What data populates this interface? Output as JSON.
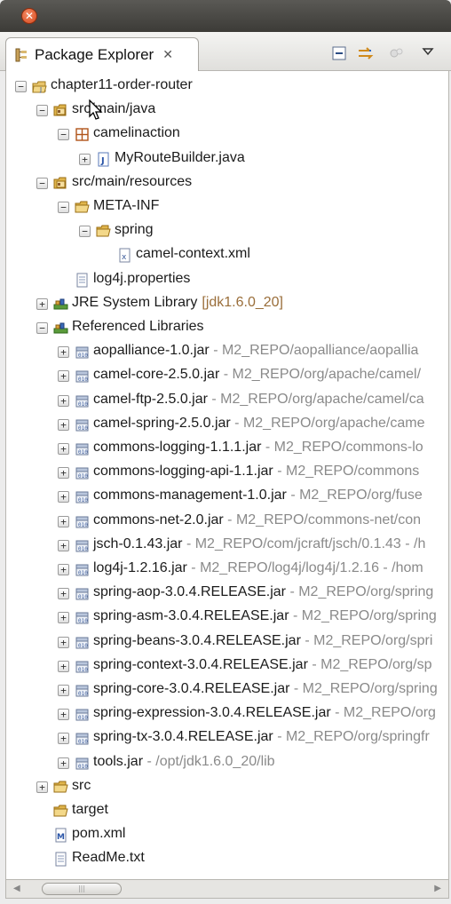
{
  "window": {
    "close_glyph": "✕"
  },
  "view": {
    "tab_title": "Package Explorer",
    "tab_close_glyph": "✕",
    "toolbar_icons": [
      "collapse-all-icon",
      "link-with-editor-icon",
      "focus-icon",
      "view-menu-icon"
    ]
  },
  "tree": [
    {
      "depth": 0,
      "toggle": "−",
      "icon": "project-icon",
      "label": "chapter11-order-router",
      "decoration": ""
    },
    {
      "depth": 1,
      "toggle": "−",
      "icon": "source-folder-icon",
      "label": "src/main/java",
      "decoration": ""
    },
    {
      "depth": 2,
      "toggle": "−",
      "icon": "package-icon",
      "label": "camelinaction",
      "decoration": ""
    },
    {
      "depth": 3,
      "toggle": "+",
      "icon": "java-file-icon",
      "label": "MyRouteBuilder.java",
      "decoration": ""
    },
    {
      "depth": 1,
      "toggle": "−",
      "icon": "source-folder-icon",
      "label": "src/main/resources",
      "decoration": ""
    },
    {
      "depth": 2,
      "toggle": "−",
      "icon": "folder-open-icon",
      "label": "META-INF",
      "decoration": ""
    },
    {
      "depth": 3,
      "toggle": "−",
      "icon": "folder-open-icon",
      "label": "spring",
      "decoration": ""
    },
    {
      "depth": 4,
      "toggle": "",
      "icon": "xml-file-icon",
      "label": "camel-context.xml",
      "decoration": ""
    },
    {
      "depth": 2,
      "toggle": "",
      "icon": "properties-file-icon",
      "label": "log4j.properties",
      "decoration": ""
    },
    {
      "depth": 1,
      "toggle": "+",
      "icon": "library-icon",
      "label": "JRE System Library",
      "decoration": "[jdk1.6.0_20]"
    },
    {
      "depth": 1,
      "toggle": "−",
      "icon": "library-icon",
      "label": "Referenced Libraries",
      "decoration": ""
    },
    {
      "depth": 2,
      "toggle": "+",
      "icon": "jar-icon",
      "label": "aopalliance-1.0.jar",
      "decoration": " - M2_REPO/aopalliance/aopallia"
    },
    {
      "depth": 2,
      "toggle": "+",
      "icon": "jar-icon",
      "label": "camel-core-2.5.0.jar",
      "decoration": " - M2_REPO/org/apache/camel/"
    },
    {
      "depth": 2,
      "toggle": "+",
      "icon": "jar-icon",
      "label": "camel-ftp-2.5.0.jar",
      "decoration": " - M2_REPO/org/apache/camel/ca"
    },
    {
      "depth": 2,
      "toggle": "+",
      "icon": "jar-icon",
      "label": "camel-spring-2.5.0.jar",
      "decoration": " - M2_REPO/org/apache/came"
    },
    {
      "depth": 2,
      "toggle": "+",
      "icon": "jar-icon",
      "label": "commons-logging-1.1.1.jar",
      "decoration": " - M2_REPO/commons-lo"
    },
    {
      "depth": 2,
      "toggle": "+",
      "icon": "jar-icon",
      "label": "commons-logging-api-1.1.jar",
      "decoration": " - M2_REPO/commons"
    },
    {
      "depth": 2,
      "toggle": "+",
      "icon": "jar-icon",
      "label": "commons-management-1.0.jar",
      "decoration": " - M2_REPO/org/fuse"
    },
    {
      "depth": 2,
      "toggle": "+",
      "icon": "jar-icon",
      "label": "commons-net-2.0.jar",
      "decoration": " - M2_REPO/commons-net/con"
    },
    {
      "depth": 2,
      "toggle": "+",
      "icon": "jar-icon",
      "label": "jsch-0.1.43.jar",
      "decoration": " - M2_REPO/com/jcraft/jsch/0.1.43 - /h"
    },
    {
      "depth": 2,
      "toggle": "+",
      "icon": "jar-icon",
      "label": "log4j-1.2.16.jar",
      "decoration": " - M2_REPO/log4j/log4j/1.2.16 - /hom"
    },
    {
      "depth": 2,
      "toggle": "+",
      "icon": "jar-icon",
      "label": "spring-aop-3.0.4.RELEASE.jar",
      "decoration": " - M2_REPO/org/spring"
    },
    {
      "depth": 2,
      "toggle": "+",
      "icon": "jar-icon",
      "label": "spring-asm-3.0.4.RELEASE.jar",
      "decoration": " - M2_REPO/org/spring"
    },
    {
      "depth": 2,
      "toggle": "+",
      "icon": "jar-icon",
      "label": "spring-beans-3.0.4.RELEASE.jar",
      "decoration": " - M2_REPO/org/spri"
    },
    {
      "depth": 2,
      "toggle": "+",
      "icon": "jar-icon",
      "label": "spring-context-3.0.4.RELEASE.jar",
      "decoration": " - M2_REPO/org/sp"
    },
    {
      "depth": 2,
      "toggle": "+",
      "icon": "jar-icon",
      "label": "spring-core-3.0.4.RELEASE.jar",
      "decoration": " - M2_REPO/org/spring"
    },
    {
      "depth": 2,
      "toggle": "+",
      "icon": "jar-icon",
      "label": "spring-expression-3.0.4.RELEASE.jar",
      "decoration": " - M2_REPO/org"
    },
    {
      "depth": 2,
      "toggle": "+",
      "icon": "jar-icon",
      "label": "spring-tx-3.0.4.RELEASE.jar",
      "decoration": " - M2_REPO/org/springfr"
    },
    {
      "depth": 2,
      "toggle": "+",
      "icon": "jar-icon",
      "label": "tools.jar",
      "decoration": " - /opt/jdk1.6.0_20/lib"
    },
    {
      "depth": 1,
      "toggle": "+",
      "icon": "folder-icon",
      "label": "src",
      "decoration": ""
    },
    {
      "depth": 1,
      "toggle": "",
      "icon": "folder-icon",
      "label": "target",
      "decoration": ""
    },
    {
      "depth": 1,
      "toggle": "",
      "icon": "maven-pom-icon",
      "label": "pom.xml",
      "decoration": ""
    },
    {
      "depth": 1,
      "toggle": "",
      "icon": "text-file-icon",
      "label": "ReadMe.txt",
      "decoration": ""
    }
  ],
  "scrollbar": {
    "left_arrow": "◀",
    "right_arrow": "▶",
    "thumb_grip": "|||"
  }
}
